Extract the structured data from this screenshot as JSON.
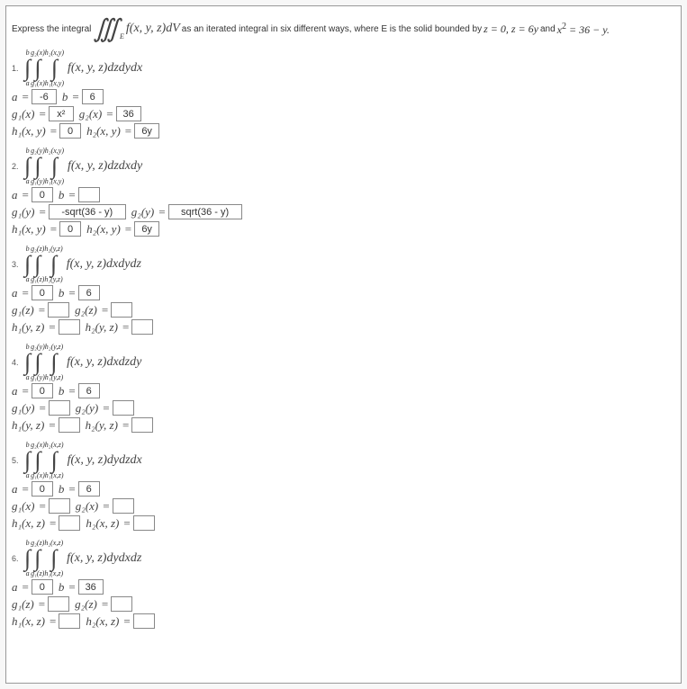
{
  "prompt": {
    "t1": "Express the integral",
    "triple": "∭",
    "sub": "E",
    "integrand": "f(x, y, z)dV",
    "t2": "as an iterated integral in six different ways, where E is the solid bounded by",
    "eq1": "z = 0, z = 6y",
    "and": "and",
    "eq2": "x",
    "sup": "2",
    "eq3": " = 36 − y."
  },
  "parts": [
    {
      "num": "1.",
      "outerUp": "b",
      "outerLo": "a",
      "midUp": "g₂(x)",
      "midLo": "g₁(x)",
      "inUp": "h₂(x,y)",
      "inLo": "h₁(x,y)",
      "integ": "f(x, y, z)dzdydx",
      "rows": [
        {
          "pairs": [
            {
              "l": "a",
              "v": "-6",
              "w": "w28"
            },
            {
              "l": "b",
              "v": "6",
              "w": "w20"
            }
          ]
        },
        {
          "pairs": [
            {
              "l": "g₁(x)",
              "v": "x²",
              "w": "w28"
            },
            {
              "l": "g₂(x)",
              "v": "36",
              "w": "w28"
            }
          ]
        },
        {
          "pairs": [
            {
              "l": "h₁(x, y)",
              "v": "0",
              "w": "w20"
            },
            {
              "l": "h₂(x, y)",
              "v": "6y",
              "w": "w28"
            }
          ]
        }
      ]
    },
    {
      "num": "2.",
      "outerUp": "b",
      "outerLo": "a",
      "midUp": "g₂(y)",
      "midLo": "g₁(y)",
      "inUp": "h₂(x,y)",
      "inLo": "h₁(x,y)",
      "integ": "f(x, y, z)dzdxdy",
      "rows": [
        {
          "pairs": [
            {
              "l": "a",
              "v": "0",
              "w": "w20"
            },
            {
              "l": "b",
              "v": "",
              "w": "w20"
            }
          ]
        },
        {
          "pairs": [
            {
              "l": "g₁(y)",
              "v": "-sqrt(36 - y)",
              "w": "w90"
            },
            {
              "l": "g₂(y)",
              "v": "sqrt(36 - y)",
              "w": "w80"
            }
          ]
        },
        {
          "pairs": [
            {
              "l": "h₁(x, y)",
              "v": "0",
              "w": "w20"
            },
            {
              "l": "h₂(x, y)",
              "v": "6y",
              "w": "w28"
            }
          ]
        }
      ]
    },
    {
      "num": "3.",
      "outerUp": "b",
      "outerLo": "a",
      "midUp": "g₂(z)",
      "midLo": "g₁(z)",
      "inUp": "h₂(y,z)",
      "inLo": "h₁(y,z)",
      "integ": "f(x, y, z)dxdydz",
      "rows": [
        {
          "pairs": [
            {
              "l": "a",
              "v": "0",
              "w": "w20"
            },
            {
              "l": "b",
              "v": "6",
              "w": "w20"
            }
          ]
        },
        {
          "pairs": [
            {
              "l": "g₁(z)",
              "v": "",
              "w": "w20"
            },
            {
              "l": "g₂(z)",
              "v": "",
              "w": "w20"
            }
          ]
        },
        {
          "pairs": [
            {
              "l": "h₁(y, z)",
              "v": "",
              "w": "w20"
            },
            {
              "l": "h₂(y, z)",
              "v": "",
              "w": "w20"
            }
          ]
        }
      ]
    },
    {
      "num": "4.",
      "outerUp": "b",
      "outerLo": "a",
      "midUp": "g₂(y)",
      "midLo": "g₁(y)",
      "inUp": "h₂(y,z)",
      "inLo": "h₁(y,z)",
      "integ": "f(x, y, z)dxdzdy",
      "rows": [
        {
          "pairs": [
            {
              "l": "a",
              "v": "0",
              "w": "w20"
            },
            {
              "l": "b",
              "v": "6",
              "w": "w20"
            }
          ]
        },
        {
          "pairs": [
            {
              "l": "g₁(y)",
              "v": "",
              "w": "w20"
            },
            {
              "l": "g₂(y)",
              "v": "",
              "w": "w20"
            }
          ]
        },
        {
          "pairs": [
            {
              "l": "h₁(y, z)",
              "v": "",
              "w": "w20"
            },
            {
              "l": "h₂(y, z)",
              "v": "",
              "w": "w20"
            }
          ]
        }
      ]
    },
    {
      "num": "5.",
      "outerUp": "b",
      "outerLo": "a",
      "midUp": "g₂(x)",
      "midLo": "g₁(x)",
      "inUp": "h₂(x,z)",
      "inLo": "h₁(x,z)",
      "integ": "f(x, y, z)dydzdx",
      "rows": [
        {
          "pairs": [
            {
              "l": "a",
              "v": "0",
              "w": "w20"
            },
            {
              "l": "b",
              "v": "6",
              "w": "w20"
            }
          ]
        },
        {
          "pairs": [
            {
              "l": "g₁(x)",
              "v": "",
              "w": "w20"
            },
            {
              "l": "g₂(x)",
              "v": "",
              "w": "w20"
            }
          ]
        },
        {
          "pairs": [
            {
              "l": "h₁(x, z)",
              "v": "",
              "w": "w20"
            },
            {
              "l": "h₂(x, z)",
              "v": "",
              "w": "w20"
            }
          ]
        }
      ]
    },
    {
      "num": "6.",
      "outerUp": "b",
      "outerLo": "a",
      "midUp": "g₂(z)",
      "midLo": "g₁(z)",
      "inUp": "h₂(x,z)",
      "inLo": "h₁(x,z)",
      "integ": "f(x, y, z)dydxdz",
      "rows": [
        {
          "pairs": [
            {
              "l": "a",
              "v": "0",
              "w": "w20"
            },
            {
              "l": "b",
              "v": "36",
              "w": "w28"
            }
          ]
        },
        {
          "pairs": [
            {
              "l": "g₁(z)",
              "v": "",
              "w": "w20"
            },
            {
              "l": "g₂(z)",
              "v": "",
              "w": "w20"
            }
          ]
        },
        {
          "pairs": [
            {
              "l": "h₁(x, z)",
              "v": "",
              "w": "w20"
            },
            {
              "l": "h₂(x, z)",
              "v": "",
              "w": "w20"
            }
          ]
        }
      ]
    }
  ]
}
